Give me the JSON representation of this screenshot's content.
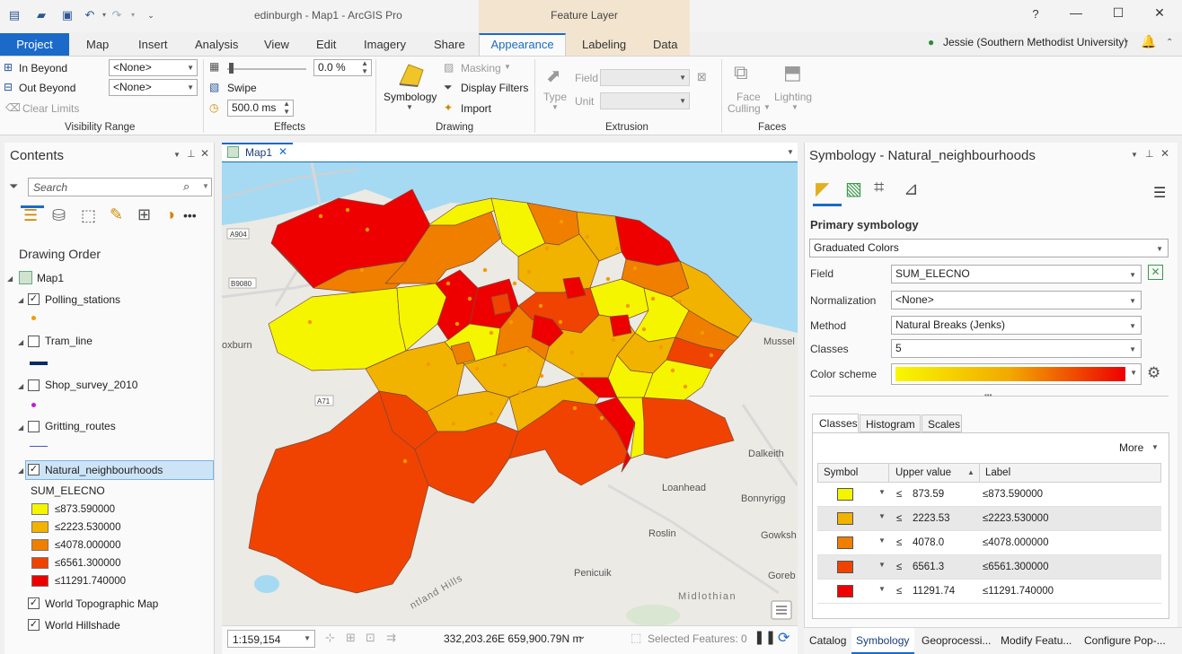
{
  "app": {
    "document_title": "edinburgh - Map1 - ArcGIS Pro",
    "context_group": "Feature Layer",
    "help": "?",
    "user": "Jessie (Southern Methodist University)"
  },
  "tabs": [
    {
      "label": "Project"
    },
    {
      "label": "Map"
    },
    {
      "label": "Insert"
    },
    {
      "label": "Analysis"
    },
    {
      "label": "View"
    },
    {
      "label": "Edit"
    },
    {
      "label": "Imagery"
    },
    {
      "label": "Share"
    },
    {
      "label": "Appearance"
    },
    {
      "label": "Labeling"
    },
    {
      "label": "Data"
    }
  ],
  "ribbon": {
    "visibility": {
      "in_beyond": "In Beyond",
      "out_beyond": "Out Beyond",
      "clear_limits": "Clear Limits",
      "in_value": "<None>",
      "out_value": "<None>",
      "group": "Visibility Range"
    },
    "effects": {
      "transparency": "0.0  %",
      "swipe": "Swipe",
      "flicker": "500.0  ms",
      "group": "Effects"
    },
    "drawing": {
      "symbology": "Symbology",
      "masking": "Masking",
      "display_filters": "Display Filters",
      "import": "Import",
      "group": "Drawing"
    },
    "extrusion": {
      "type": "Type",
      "field": "Field",
      "unit": "Unit",
      "group": "Extrusion"
    },
    "faces": {
      "face": "Face",
      "culling": "Culling",
      "lighting": "Lighting",
      "group": "Faces"
    }
  },
  "contents": {
    "title": "Contents",
    "search_placeholder": "Search",
    "drawing_order": "Drawing Order",
    "map": "Map1",
    "layers": [
      {
        "name": "Polling_stations",
        "checked": true
      },
      {
        "name": "Tram_line",
        "checked": false
      },
      {
        "name": "Shop_survey_2010",
        "checked": false
      },
      {
        "name": "Gritting_routes",
        "checked": false
      },
      {
        "name": "Natural_neighbourhoods",
        "checked": true
      }
    ],
    "legend_field": "SUM_ELECNO",
    "legend": [
      {
        "label": "≤873.590000",
        "color": "#f5f500"
      },
      {
        "label": "≤2223.530000",
        "color": "#f2b200"
      },
      {
        "label": "≤4078.000000",
        "color": "#f07f00"
      },
      {
        "label": "≤6561.300000",
        "color": "#f04200"
      },
      {
        "label": "≤11291.740000",
        "color": "#ee0000"
      }
    ],
    "basemaps": [
      {
        "name": "World Topographic Map",
        "checked": true
      },
      {
        "name": "World Hillshade",
        "checked": true
      }
    ]
  },
  "map": {
    "tab": "Map1",
    "labels": {
      "a904": "A904",
      "b9080": "B9080",
      "a71": "A71",
      "loxburn": "oxburn",
      "mussel": "Mussel",
      "dalkeith": "Dalkeith",
      "loanhead": "Loanhead",
      "bonnyrigg": "Bonnyrigg",
      "roslin": "Roslin",
      "gowksh": "Gowksh",
      "gorebr": "Goreb",
      "penicuik": "Penicuik",
      "midlothian": "Midlothian",
      "pentland": "ntland Hills"
    },
    "scale": "1:159,154",
    "coordinates": "332,203.26E 659,900.79N m",
    "selected_features": "Selected Features: 0"
  },
  "symbology": {
    "title": "Symbology - Natural_neighbourhoods",
    "primary": "Primary symbology",
    "renderer": "Graduated Colors",
    "field_label": "Field",
    "field": "SUM_ELECNO",
    "normalization_label": "Normalization",
    "normalization": "<None>",
    "method_label": "Method",
    "method": "Natural Breaks (Jenks)",
    "classes_label": "Classes",
    "classes": "5",
    "scheme_label": "Color scheme",
    "subtabs": [
      "Classes",
      "Histogram",
      "Scales"
    ],
    "more": "More",
    "columns": [
      "Symbol",
      "Upper value",
      "Label"
    ],
    "rows": [
      {
        "le": "≤",
        "upper": "873.59",
        "label": "≤873.590000",
        "color": "#f5f500"
      },
      {
        "le": "≤",
        "upper": "2223.53",
        "label": "≤2223.530000",
        "color": "#f2b200"
      },
      {
        "le": "≤",
        "upper": "4078.0",
        "label": "≤4078.000000",
        "color": "#f07f00"
      },
      {
        "le": "≤",
        "upper": "6561.3",
        "label": "≤6561.300000",
        "color": "#f04200"
      },
      {
        "le": "≤",
        "upper": "11291.74",
        "label": "≤11291.740000",
        "color": "#ee0000"
      }
    ]
  },
  "bottom_tabs": [
    "Catalog",
    "Symbology",
    "Geoprocessi...",
    "Modify Featu...",
    "Configure Pop-..."
  ]
}
